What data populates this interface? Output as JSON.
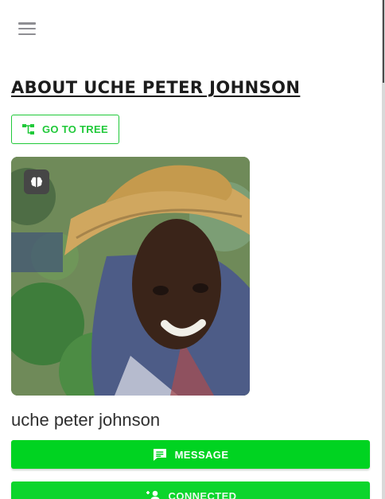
{
  "header": {
    "menu_icon": "hamburger-menu-icon"
  },
  "profile": {
    "title": "ABOUT UCHE PETER JOHNSON",
    "go_to_tree_label": "GO TO TREE",
    "go_to_tree_icon": "family-tree-icon",
    "photo_badge_icon": "brain-icon",
    "name": "uche peter johnson"
  },
  "actions": {
    "message_label": "MESSAGE",
    "message_icon": "chat-message-icon",
    "connected_label": "CONNECTED",
    "connected_icon": "person-add-icon"
  },
  "colors": {
    "accent": "#21c93a",
    "button_fill": "#00d321",
    "title_text": "#1c1c1c",
    "name_text": "#2f2f2f",
    "menu_icon": "#8e8e93"
  }
}
